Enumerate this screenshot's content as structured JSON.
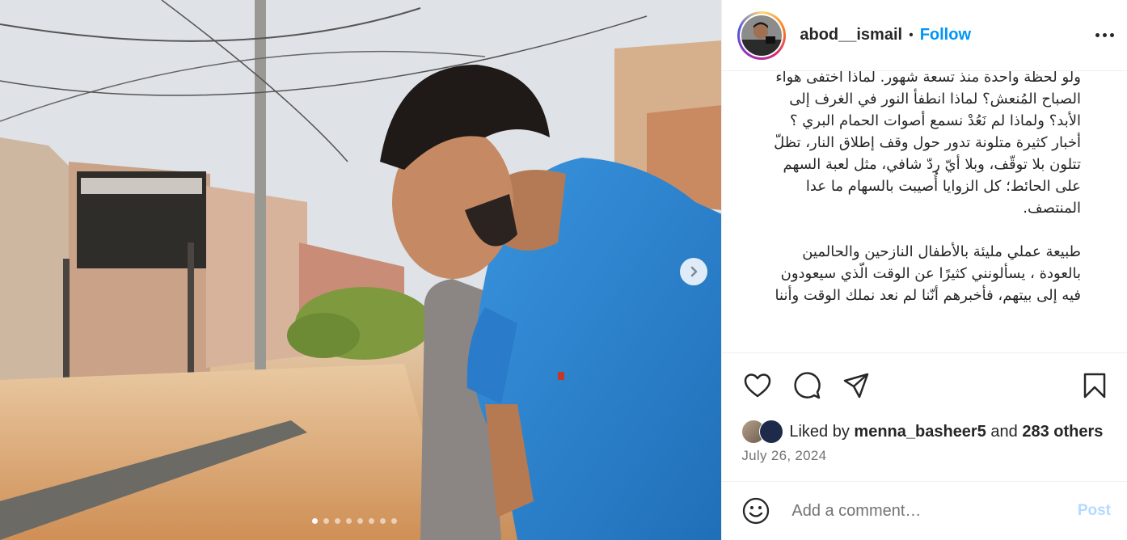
{
  "media": {
    "sign_text": "",
    "carousel": {
      "total": 8,
      "current": 1
    },
    "next_icon": "chevron-right-icon"
  },
  "header": {
    "username": "abod__ismail",
    "separator": "•",
    "follow_label": "Follow",
    "more_icon": "more-dots-icon"
  },
  "caption": {
    "paragraphs": [
      "ولو لحظة واحدة منذ تسعة شهور. لماذا اختفى هواء الصباح المُنعش؟ لماذا انطفأ النور في الغرف إلى الأبد؟ ولماذا لم نَعُدْ نسمع أصوات الحمام البري ؟ أخبار كثيرة متلونة تدور حول وقف إطلاق النار، تظلّ تتلون بلا توقّف، وبلا أيّ ردّ شافي، مثل لعبة السهم على الحائط؛ كل الزوايا أُصيبت بالسهام ما عدا المنتصف.",
      "طبيعة عملي مليئة بالأطفال النازحين والحالمين بالعودة ، يسألونني كثيرًا عن الوقت الّذي سيعودون فيه إلى بيتهم، فأخبرهم أنّنا لم نعد نملك الوقت وأننا"
    ]
  },
  "actions": {
    "icons": [
      "heart-icon",
      "comment-icon",
      "share-icon",
      "bookmark-icon"
    ]
  },
  "likes": {
    "prefix": "Liked by ",
    "user": "menna_basheer5",
    "middle": " and ",
    "others": "283 others"
  },
  "date": "July 26, 2024",
  "comment": {
    "placeholder": "Add a comment…",
    "post_label": "Post"
  },
  "colors": {
    "accent": "#0095f6",
    "post_disabled": "#b3dbff",
    "muted": "#737373",
    "shirt": "#2f86d1"
  }
}
